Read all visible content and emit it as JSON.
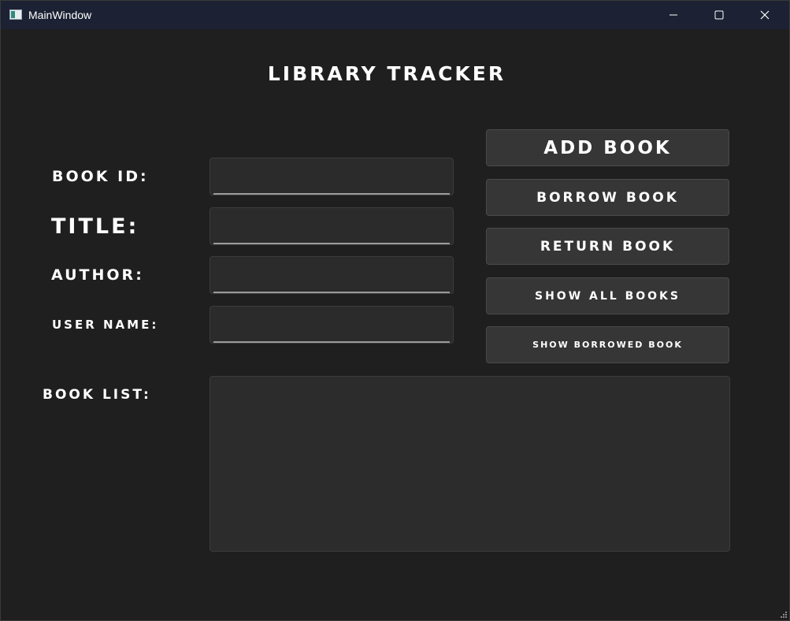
{
  "window": {
    "title": "MainWindow",
    "controls": [
      "minimize-icon",
      "maximize-icon",
      "close-icon"
    ]
  },
  "app": {
    "title": "LIBRARY TRACKER"
  },
  "form": {
    "book_id_label": "BOOK ID:",
    "title_label": "TITLE:",
    "author_label": "AUTHOR:",
    "user_name_label": "USER NAME:",
    "book_id_value": "",
    "title_value": "",
    "author_value": "",
    "user_name_value": ""
  },
  "actions": {
    "add_book": "ADD BOOK",
    "borrow_book": "BORROW BOOK",
    "return_book": "RETURN BOOK",
    "show_all_books": "SHOW ALL BOOKS",
    "show_borrowed_book": "SHOW BORROWED BOOK"
  },
  "book_list": {
    "label": "BOOK LIST:",
    "items": []
  },
  "colors": {
    "background": "#1f1f1f",
    "titlebar": "#1c2233",
    "field": "#2b2b2b",
    "button": "#363636",
    "text": "#ffffff"
  }
}
